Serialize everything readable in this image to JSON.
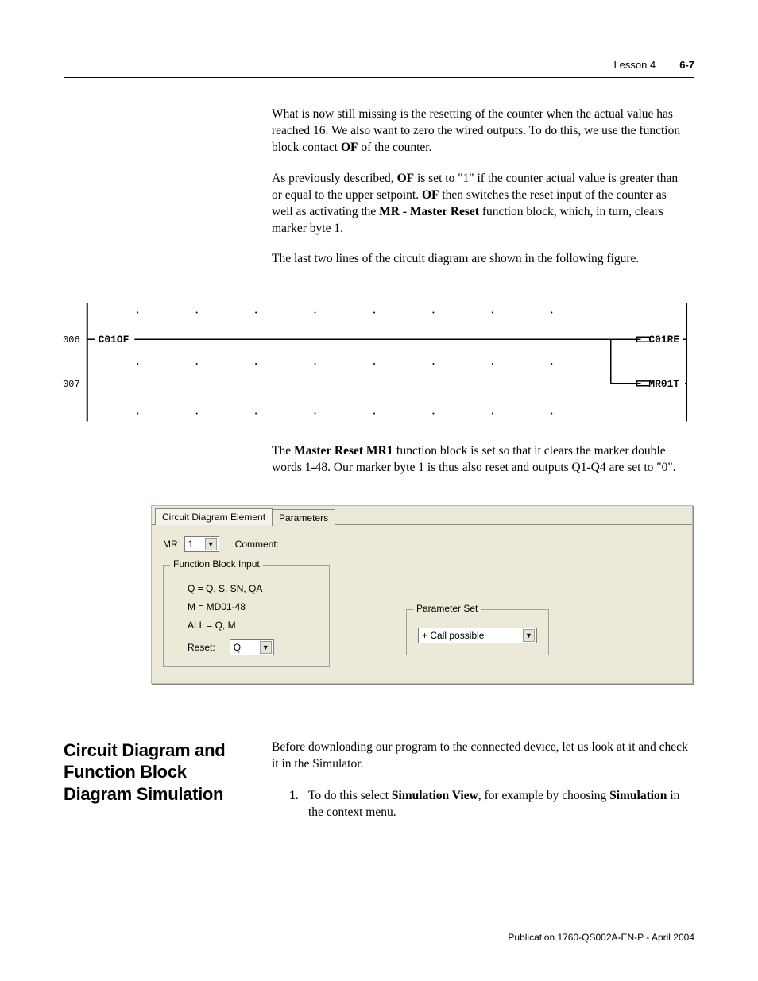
{
  "header": {
    "lesson": "Lesson 4",
    "pagenum": "6-7"
  },
  "paras": {
    "p1a": "What is now still missing is the resetting of the counter when the actual value has reached 16. We also want to zero the wired outputs. To do this, we use the function block contact ",
    "p1_of": "OF",
    "p1b": " of the counter.",
    "p2a": "As previously described, ",
    "p2_of1": "OF",
    "p2b": " is set to \"1\" if the counter actual value is greater than or equal to the upper setpoint. ",
    "p2_of2": "OF",
    "p2c": " then switches the reset input of the counter as well as activating the ",
    "p2_mr": "MR - Master Reset",
    "p2d": " function block, which, in turn, clears marker byte 1.",
    "p3": "The last two lines of the circuit diagram are shown in the following figure.",
    "p4a": "The ",
    "p4_mr1": "Master Reset MR1",
    "p4b": " function block is set so that it clears the marker double words 1-48. Our marker byte 1 is thus also reset and outputs Q1-Q4 are set to \"0\"."
  },
  "ladder": {
    "row006": "006",
    "row007": "007",
    "c01of": "C01OF",
    "c01re": "C01RE",
    "mr01t": "MR01T_"
  },
  "dialog": {
    "tab1": "Circuit Diagram Element",
    "tab2": "Parameters",
    "mr_label": "MR",
    "mr_value": "1",
    "comment_label": "Comment:",
    "fb_legend": "Function Block Input",
    "fb_line1": "Q = Q, S, SN, QA",
    "fb_line2": "M = MD01-48",
    "fb_line3": "ALL = Q, M",
    "reset_label": "Reset:",
    "reset_value": "Q",
    "param_legend": "Parameter Set",
    "param_value": "+ Call possible"
  },
  "section": {
    "heading": "Circuit Diagram and Function Block Diagram Simulation",
    "intro": "Before downloading our program to the connected device, let us look at it and check it in the Simulator.",
    "step_num": "1.",
    "step_a": "To do this select ",
    "step_sv": "Simulation View",
    "step_b": ", for example by choosing ",
    "step_sim": "Simulation",
    "step_c": " in the context menu."
  },
  "footer": "Publication 1760-QS002A-EN-P - April 2004"
}
